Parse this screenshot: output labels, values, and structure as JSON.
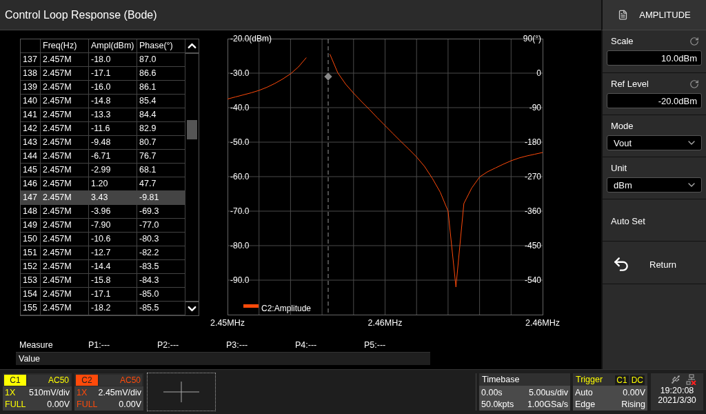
{
  "title": "Control Loop Response (Bode)",
  "table": {
    "columns": [
      "Freq(Hz)",
      "Ampl(dBm)",
      "Phase(°)"
    ],
    "rows": [
      {
        "index": "137",
        "freq": "2.457M",
        "ampl": "-18.0",
        "phase": "87.0",
        "selected": false
      },
      {
        "index": "138",
        "freq": "2.457M",
        "ampl": "-17.1",
        "phase": "86.6",
        "selected": false
      },
      {
        "index": "139",
        "freq": "2.457M",
        "ampl": "-16.0",
        "phase": "86.1",
        "selected": false
      },
      {
        "index": "140",
        "freq": "2.457M",
        "ampl": "-14.8",
        "phase": "85.4",
        "selected": false
      },
      {
        "index": "141",
        "freq": "2.457M",
        "ampl": "-13.3",
        "phase": "84.4",
        "selected": false
      },
      {
        "index": "142",
        "freq": "2.457M",
        "ampl": "-11.6",
        "phase": "82.9",
        "selected": false
      },
      {
        "index": "143",
        "freq": "2.457M",
        "ampl": "-9.48",
        "phase": "80.7",
        "selected": false
      },
      {
        "index": "144",
        "freq": "2.457M",
        "ampl": "-6.71",
        "phase": "76.7",
        "selected": false
      },
      {
        "index": "145",
        "freq": "2.457M",
        "ampl": "-2.99",
        "phase": "68.1",
        "selected": false
      },
      {
        "index": "146",
        "freq": "2.457M",
        "ampl": "1.20",
        "phase": "47.7",
        "selected": false
      },
      {
        "index": "147",
        "freq": "2.457M",
        "ampl": "3.43",
        "phase": "-9.81",
        "selected": true
      },
      {
        "index": "148",
        "freq": "2.457M",
        "ampl": "-3.96",
        "phase": "-69.3",
        "selected": false
      },
      {
        "index": "149",
        "freq": "2.457M",
        "ampl": "-7.90",
        "phase": "-77.0",
        "selected": false
      },
      {
        "index": "150",
        "freq": "2.457M",
        "ampl": "-10.6",
        "phase": "-80.3",
        "selected": false
      },
      {
        "index": "151",
        "freq": "2.457M",
        "ampl": "-12.7",
        "phase": "-82.2",
        "selected": false
      },
      {
        "index": "152",
        "freq": "2.457M",
        "ampl": "-14.4",
        "phase": "-83.5",
        "selected": false
      },
      {
        "index": "153",
        "freq": "2.457M",
        "ampl": "-15.8",
        "phase": "-84.3",
        "selected": false
      },
      {
        "index": "154",
        "freq": "2.457M",
        "ampl": "-17.1",
        "phase": "-85.0",
        "selected": false
      },
      {
        "index": "155",
        "freq": "2.457M",
        "ampl": "-18.2",
        "phase": "-85.5",
        "selected": false
      }
    ]
  },
  "plot": {
    "phase_axis_labels": [
      "90(°)",
      "0",
      "-90",
      "-180",
      "-270",
      "-360",
      "-450",
      "-540"
    ],
    "chart_data": {
      "type": "line",
      "ylim": [
        -100,
        -20
      ],
      "categories": [
        "2.45MHz",
        null,
        null,
        null,
        null,
        null,
        null,
        null,
        null,
        null,
        null,
        null,
        null,
        null,
        null,
        null,
        null,
        null,
        null,
        null,
        "2.46MHz",
        null,
        null,
        null,
        null,
        null,
        null,
        null,
        null,
        null,
        null,
        null,
        null,
        null,
        null,
        null,
        null,
        null,
        null,
        null,
        "2.46MHz"
      ],
      "yticks": [
        {
          "value": -20,
          "label": "-20.0(dBm)"
        },
        {
          "value": -30,
          "label": "-30.0"
        },
        {
          "value": -40,
          "label": "-40.0"
        },
        {
          "value": -50,
          "label": "-50.0"
        },
        {
          "value": -60,
          "label": "-60.0"
        },
        {
          "value": -70,
          "label": "-70.0"
        },
        {
          "value": -80,
          "label": "-80.0"
        },
        {
          "value": -90,
          "label": "-90.0"
        }
      ],
      "series": [
        {
          "name": "C2:Amplitude",
          "color": "#ff4a0a",
          "values": [
            -37.5,
            -36.9,
            -36.3,
            -35.7,
            -35.0,
            -34.1,
            -33.0,
            -31.7,
            -30.2,
            -28.2,
            -25.5,
            null,
            null,
            -24.5,
            -29.9,
            -33.2,
            -35.8,
            -38.2,
            -40.5,
            -42.9,
            -45.2,
            -47.5,
            -49.8,
            -52.0,
            -54.3,
            -57.0,
            -60.5,
            -64.5,
            -70.0,
            -92.0,
            -67.8,
            -63.3,
            -60.1,
            -58.6,
            -57.5,
            -56.4,
            -55.4,
            -54.6,
            -54.0,
            -53.5,
            -53.0
          ]
        }
      ],
      "grid": true
    }
  },
  "measure": {
    "label": "Measure",
    "params": [
      "P1:---",
      "P2:---",
      "P3:---",
      "P4:---",
      "P5:---"
    ],
    "value_label": "Value"
  },
  "menu": {
    "title": "AMPLITUDE",
    "items": [
      {
        "kind": "field",
        "label": "Scale",
        "value": "10.0dBm"
      },
      {
        "kind": "field",
        "label": "Ref Level",
        "value": "-20.0dBm"
      },
      {
        "kind": "dropdown",
        "label": "Mode",
        "value": "Vout"
      },
      {
        "kind": "dropdown",
        "label": "Unit",
        "value": "dBm"
      },
      {
        "kind": "action",
        "label": "Auto Set"
      },
      {
        "kind": "return",
        "label": "Return"
      }
    ]
  },
  "channels": [
    {
      "name": "C1",
      "coupling": "AC50",
      "probe": "1X",
      "scale": "510mV/div",
      "bandwidth": "FULL",
      "offset": "0.00V",
      "color": "#ffff00"
    },
    {
      "name": "C2",
      "coupling": "AC50",
      "probe": "1X",
      "scale": "2.45mV/div",
      "bandwidth": "FULL",
      "offset": "0.00V",
      "color": "#ff4a0a"
    }
  ],
  "timebase": {
    "title": "Timebase",
    "delay": "0.00s",
    "scale": "5.00us/div",
    "points": "50.0kpts",
    "rate": "1.00GSa/s"
  },
  "trigger": {
    "title": "Trigger",
    "source": "C1",
    "coupling": "DC",
    "mode": "Auto",
    "level": "0.00V",
    "type": "Edge",
    "slope": "Rising"
  },
  "status": {
    "time": "19:20:08",
    "date": "2021/3/30"
  }
}
